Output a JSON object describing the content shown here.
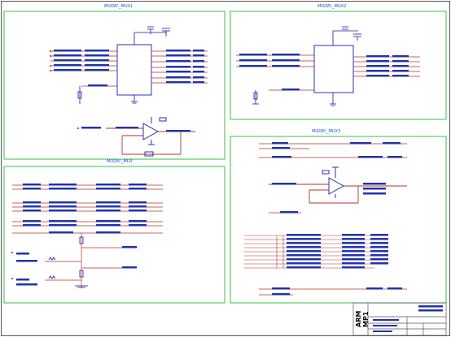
{
  "sections": {
    "mux1": {
      "title": "MODEL_MUX1"
    },
    "mux2": {
      "title": "MODEL_MUX2"
    },
    "mux3": {
      "title": "MODEL_MUX3"
    },
    "mux4": {
      "title": "MODEL_MUX"
    }
  },
  "title_block": {
    "brand": "",
    "vertical_text": "ARM MP1"
  },
  "colors": {
    "frame": "#35c04a",
    "wire": "#b0332a",
    "net": "#2233aa",
    "title": "#1a4fd6",
    "component": "#1a1aa8"
  }
}
